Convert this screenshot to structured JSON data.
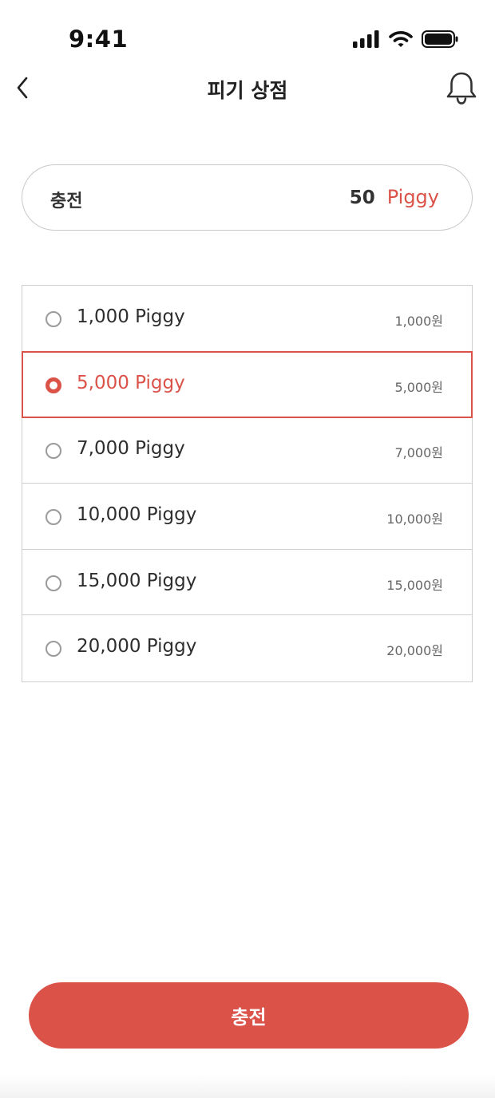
{
  "status_bar": {
    "time": "9:41"
  },
  "header": {
    "title": "피기 상점"
  },
  "balance": {
    "label": "충전",
    "amount": "50",
    "unit": "Piggy"
  },
  "options": [
    {
      "label": "1,000 Piggy",
      "price": "1,000원",
      "selected": false
    },
    {
      "label": "5,000 Piggy",
      "price": "5,000원",
      "selected": true
    },
    {
      "label": "7,000 Piggy",
      "price": "7,000원",
      "selected": false
    },
    {
      "label": "10,000 Piggy",
      "price": "10,000원",
      "selected": false
    },
    {
      "label": "15,000 Piggy",
      "price": "15,000원",
      "selected": false
    },
    {
      "label": "20,000 Piggy",
      "price": "20,000원",
      "selected": false
    }
  ],
  "charge_button": {
    "label": "충전"
  },
  "colors": {
    "accent": "#db5249",
    "border": "#cfcfcf",
    "text": "#2e2e2e"
  },
  "icons": {
    "back": "chevron-left-icon",
    "bell": "bell-icon",
    "signal": "signal-icon",
    "wifi": "wifi-icon",
    "battery": "battery-icon"
  }
}
